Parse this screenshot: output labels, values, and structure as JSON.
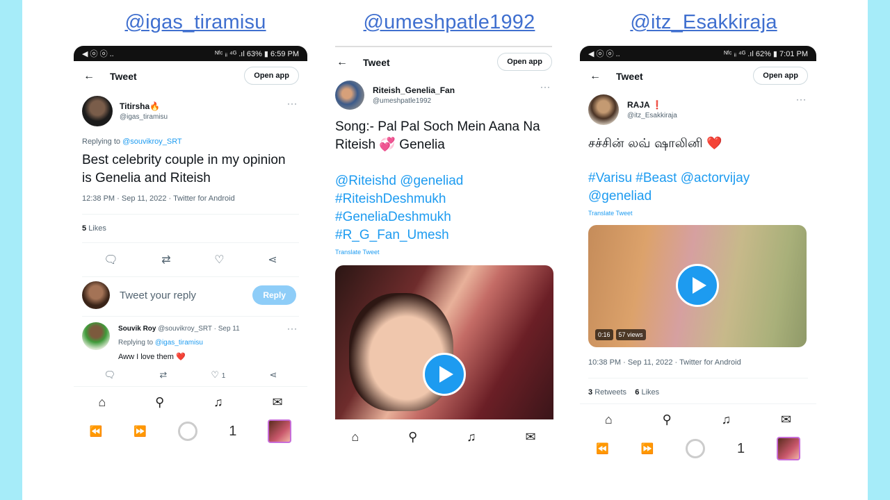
{
  "handles": [
    "@igas_tiramisu",
    "@umeshpatle1992",
    "@itz_Esakkiraja"
  ],
  "phone1": {
    "status_left": "◀ ⓞ ⓞ ..",
    "status_right": "ᴺᶠᶜ ᵢᵢ ⁴ᴳ .ıl 63% ▮ 6:59 PM",
    "back": "←",
    "title": "Tweet",
    "open_app": "Open app",
    "user_name": "Titirsha🔥",
    "user_handle": "@igas_tiramisu",
    "dots": "···",
    "replying_prefix": "Replying to",
    "replying_to": "@souvikroy_SRT",
    "text": "Best celebrity couple in my opinion is Genelia and Riteish",
    "timestamp": "12:38 PM · Sep 11, 2022 · Twitter for Android",
    "likes_count": "5",
    "likes_label": "Likes",
    "reply_placeholder": "Tweet your reply",
    "reply_button": "Reply",
    "reply": {
      "name": "Souvik Roy",
      "handle_date": "@souvikroy_SRT · Sep 11",
      "replying_prefix": "Replying to",
      "replying_to": "@igas_tiramisu",
      "text": "Aww I love them ❤️",
      "like_count": "1"
    },
    "page_number": "1"
  },
  "phone2": {
    "back": "←",
    "title": "Tweet",
    "open_app": "Open app",
    "user_name": "Riteish_Genelia_Fan",
    "user_handle": "@umeshpatle1992",
    "dots": "···",
    "text_line1": "Song:- Pal Pal Soch Mein Aana Na",
    "text_line2": "Riteish 💞 Genelia",
    "tags": [
      "@Riteishd @geneliad",
      "#RiteishDeshmukh",
      "#GeneliaDeshmukh",
      "#R_G_Fan_Umesh"
    ],
    "translate": "Translate Tweet"
  },
  "phone3": {
    "status_left": "◀ ⓞ ⓞ ..",
    "status_right": "ᴺᶠᶜ ᵢᵢ ⁴ᴳ .ıl 62% ▮ 7:01 PM",
    "back": "←",
    "title": "Tweet",
    "open_app": "Open app",
    "user_name": "RAJA ❗",
    "user_handle": "@itz_Esakkiraja",
    "dots": "···",
    "text": "சச்சின் லவ் ஷாலினி ❤️",
    "tags_line1": "#Varisu #Beast @actorvijay",
    "tags_line2": "@geneliad",
    "translate": "Translate Tweet",
    "video_time": "0:16",
    "video_views": "57 views",
    "timestamp": "10:38 PM · Sep 11, 2022 · Twitter for Android",
    "retweets_count": "3",
    "retweets_label": "Retweets",
    "likes_count": "6",
    "likes_label": "Likes",
    "page_number": "1"
  },
  "colors": {
    "accent": "#1d9bf0",
    "handle": "#3f6fcf",
    "frame": "#a6ecf9"
  }
}
